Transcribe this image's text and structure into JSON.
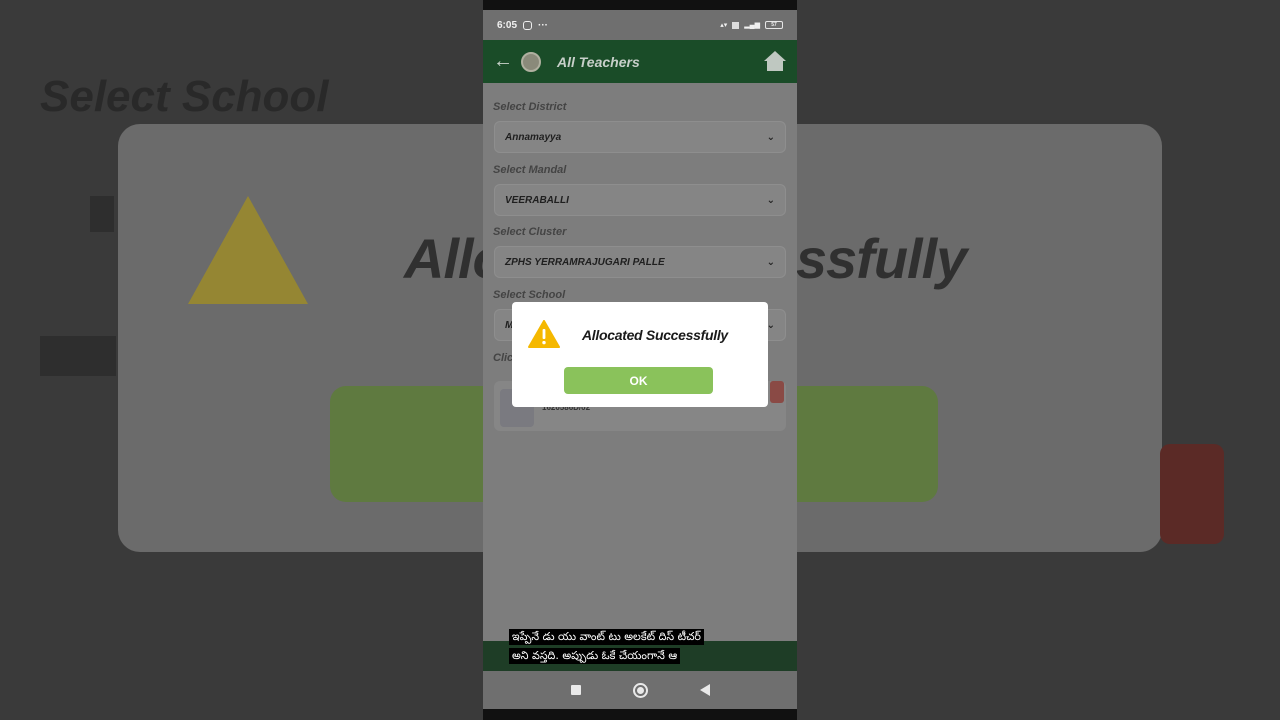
{
  "background": {
    "title": "Select School",
    "heading_fragments": [
      "Allo",
      "essfully"
    ],
    "partial_label": "Clic"
  },
  "statusbar": {
    "time": "6:05",
    "left_icons": [
      "instagram-icon",
      "more-icon"
    ],
    "battery": "57"
  },
  "appbar": {
    "title": "All Teachers"
  },
  "form": {
    "district_label": "Select District",
    "district_value": "Annamayya",
    "mandal_label": "Select Mandal",
    "mandal_value": "VEERABALLI",
    "cluster_label": "Select Cluster",
    "cluster_value": "ZPHS YERRAMRAJUGARI PALLE",
    "school_label": "Select School",
    "school_value": "M",
    "click_label": "Clic"
  },
  "teacher": {
    "id": "1620586D/02"
  },
  "dialog": {
    "message": "Allocated Successfully",
    "ok_label": "OK",
    "icon": "warning-icon",
    "icon_color": "#F5B800",
    "button_color": "#8AC25B"
  },
  "subtitles": [
    "ఇప్పేనే డు యు వాంట్ టు అలకేట్ దిస్ టీచర్",
    "అని వస్తది. అప్పుడు ఓకే చేయంగానే ఆ"
  ]
}
